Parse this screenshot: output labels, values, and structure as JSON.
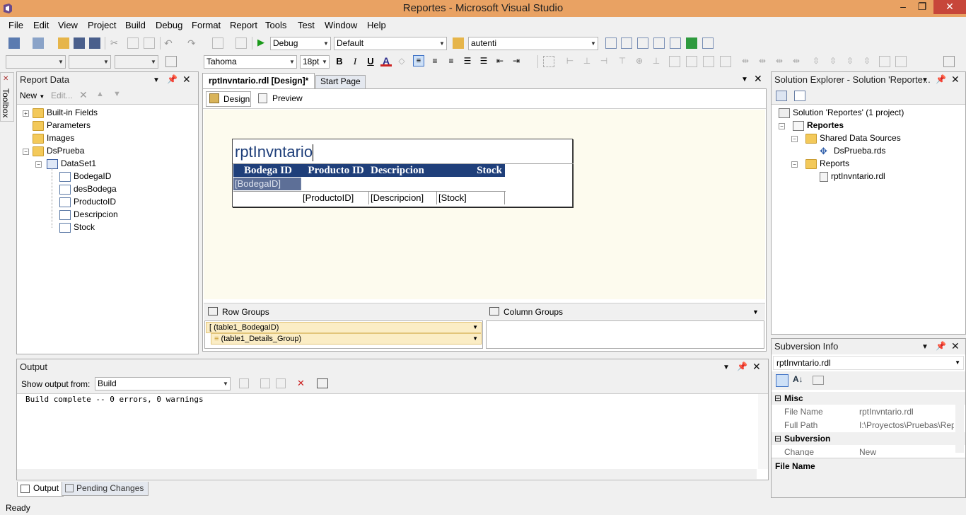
{
  "window": {
    "title": "Reportes - Microsoft Visual Studio",
    "minimize": "‒",
    "restore": "❐",
    "close": "✕"
  },
  "menu": [
    "File",
    "Edit",
    "View",
    "Project",
    "Build",
    "Debug",
    "Format",
    "Report",
    "Tools",
    "Test",
    "Window",
    "Help"
  ],
  "toolbar1": {
    "config": "Debug",
    "platform": "Default",
    "find": "autenti"
  },
  "toolbar2": {
    "font": "Tahoma",
    "size": "18pt",
    "bold": "B",
    "italic": "I",
    "underline": "U",
    "color": "A"
  },
  "report_data": {
    "title": "Report Data",
    "new_label": "New",
    "edit_label": "Edit...",
    "tree": [
      "Built-in Fields",
      "Parameters",
      "Images",
      "DsPrueba",
      "DataSet1",
      "BodegaID",
      "desBodega",
      "ProductoID",
      "Descripcion",
      "Stock"
    ]
  },
  "toolbox_label": "Toolbox",
  "doc_tabs": {
    "active": "rptInvntario.rdl [Design]*",
    "other": "Start Page"
  },
  "designer": {
    "design_tab": "Design",
    "preview_tab": "Preview",
    "report_title": "rptInvntario",
    "headers": [
      "Bodega ID",
      "Producto ID",
      "Descripcion",
      "Stock"
    ],
    "group_row": "[BodegaID]",
    "detail_row": [
      "",
      "[ProductoID]",
      "[Descripcion]",
      "[Stock]"
    ],
    "row_groups_label": "Row Groups",
    "column_groups_label": "Column Groups",
    "row_groups": [
      "(table1_BodegaID)",
      "(table1_Details_Group)"
    ]
  },
  "solution_explorer": {
    "title": "Solution Explorer - Solution 'Reporte...",
    "tree": [
      "Solution 'Reportes' (1 project)",
      "Reportes",
      "Shared Data Sources",
      "DsPrueba.rds",
      "Reports",
      "rptInvntario.rdl"
    ]
  },
  "subversion": {
    "title": "Subversion Info",
    "selected": "rptInvntario.rdl",
    "misc": "Misc",
    "rows": [
      {
        "k": "File Name",
        "v": "rptInvntario.rdl"
      },
      {
        "k": "Full Path",
        "v": "I:\\Proyectos\\Pruebas\\Rep"
      }
    ],
    "section2": "Subversion",
    "change_k": "Change",
    "change_v": "New",
    "desc": "File Name"
  },
  "output": {
    "title": "Output",
    "show_label": "Show output from:",
    "source": "Build",
    "text": "Build complete -- 0 errors, 0 warnings"
  },
  "bottom_tabs": [
    "Output",
    "Pending Changes"
  ],
  "status": "Ready"
}
